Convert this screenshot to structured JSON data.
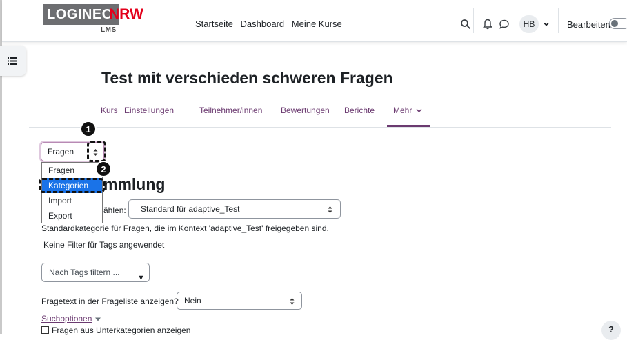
{
  "header": {
    "logo": {
      "brand": "LOGINEO",
      "region": "NRW",
      "sub": "LMS"
    },
    "nav": [
      "Startseite",
      "Dashboard",
      "Meine Kurse"
    ],
    "user_initials": "HB",
    "edit_label": "Bearbeiten",
    "edit_mode_on": false
  },
  "course": {
    "title": "Test mit verschieden schweren Fragen",
    "tabs": [
      "Kurs",
      "Einstellungen",
      "Teilnehmer/innen",
      "Bewertungen",
      "Berichte",
      "Mehr"
    ],
    "active_tab": "Mehr"
  },
  "question_bank": {
    "nav_select_value": "Fragen",
    "nav_options": [
      "Fragen",
      "Kategorien",
      "Import",
      "Export"
    ],
    "highlighted_option": "Kategorien",
    "heading_visible": "mmlung",
    "category_label_visible": "ählen:",
    "category_value": "Standard für adaptive_Test",
    "category_description": "Standardkategorie für Fragen, die im Kontext 'adaptive_Test' freigegeben sind.",
    "filter_note": "Keine Filter für Tags angewendet",
    "tags_placeholder": "Nach Tags filtern ...",
    "qtext_label": "Fragetext in der Frageliste anzeigen?",
    "qtext_value": "Nein",
    "search_options": "Suchoptionen",
    "subcategories_label": "Fragen aus Unterkategorien anzeigen",
    "subcategories_checked": false
  },
  "annotations": {
    "step1": "1",
    "step2": "2"
  },
  "help_label": "?",
  "colors": {
    "accent": "#6b3a70",
    "highlight": "#1a73e8",
    "logo_grey": "#6d6e71",
    "logo_red": "#e3001b",
    "logo_green": "#7ab51d"
  }
}
